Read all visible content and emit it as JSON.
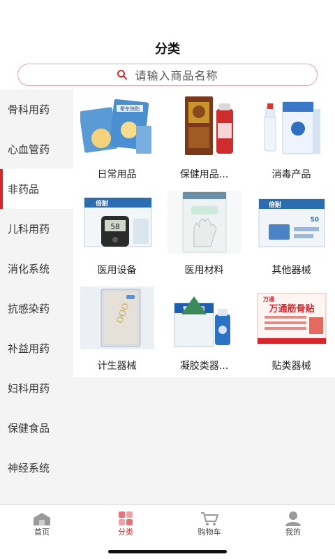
{
  "header": {
    "title": "分类"
  },
  "search": {
    "placeholder": "请输入商品名称"
  },
  "sidebar": {
    "items": [
      {
        "label": "骨科用药"
      },
      {
        "label": "心血管药"
      },
      {
        "label": "非药品"
      },
      {
        "label": "儿科用药"
      },
      {
        "label": "消化系统"
      },
      {
        "label": "抗感染药"
      },
      {
        "label": "补益用药"
      },
      {
        "label": "妇科用药"
      },
      {
        "label": "保健食品"
      },
      {
        "label": "神经系统"
      }
    ],
    "active": "非药品"
  },
  "categories": [
    {
      "label": "日常用品"
    },
    {
      "label": "保健用品..."
    },
    {
      "label": "消毒产品"
    },
    {
      "label": "医用设备"
    },
    {
      "label": "医用材料"
    },
    {
      "label": "其他器械"
    },
    {
      "label": "计生器械"
    },
    {
      "label": "凝胶类器..."
    },
    {
      "label": "贴类器械"
    }
  ],
  "product_images": {
    "patch_box_text": "晕车快贴",
    "glucose_brand": "倍耐",
    "glucose_reading": "58",
    "glucose_strip_brand": "倍耐",
    "glucose_strip_count": "50",
    "gel_brand": "雪茶清目",
    "plaster_title": "万通筋骨贴",
    "plaster_brand": "万通"
  },
  "tabbar": {
    "items": [
      {
        "label": "首页"
      },
      {
        "label": "分类"
      },
      {
        "label": "购物车"
      },
      {
        "label": "我的"
      }
    ],
    "active": "分类"
  },
  "colors": {
    "accent": "#d9252c",
    "search_border": "#e9a0a6",
    "sidebar_bg": "#f4f4f4",
    "icon_gray": "#9a9a9a"
  }
}
